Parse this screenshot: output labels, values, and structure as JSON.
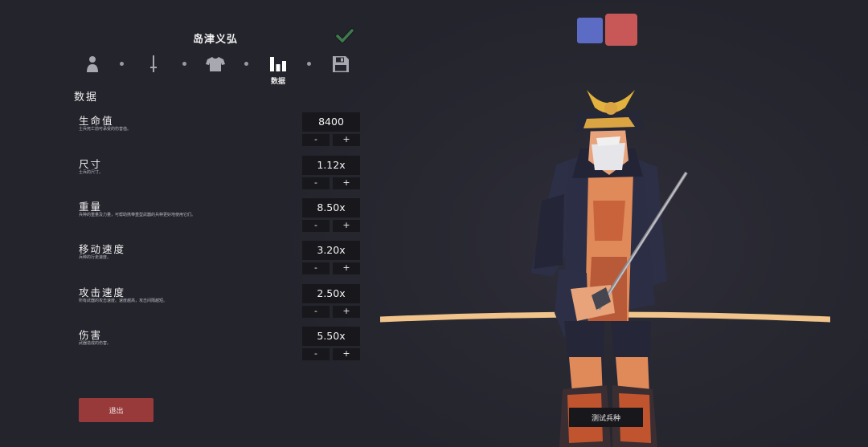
{
  "unit": {
    "name": "岛津义弘"
  },
  "tabs": [
    {
      "icon": "person-icon",
      "label": ""
    },
    {
      "icon": "sword-icon",
      "label": ""
    },
    {
      "icon": "shirt-icon",
      "label": ""
    },
    {
      "icon": "bar-chart-icon",
      "label": "数据"
    },
    {
      "icon": "save-icon",
      "label": ""
    }
  ],
  "stats_section": {
    "title": "数据",
    "rows": [
      {
        "name": "生命值",
        "desc": "士兵死亡前可承受的伤害值。",
        "value": "8400",
        "minus": "-",
        "plus": "+"
      },
      {
        "name": "尺寸",
        "desc": "士兵的尺寸。",
        "value": "1.12x",
        "minus": "-",
        "plus": "+"
      },
      {
        "name": "重量",
        "desc": "兵种的重量及力量，可帮助携带重型武器的兵种更好地使用它们。",
        "value": "8.50x",
        "minus": "-",
        "plus": "+"
      },
      {
        "name": "移动速度",
        "desc": "兵种的行走速度。",
        "value": "3.20x",
        "minus": "-",
        "plus": "+"
      },
      {
        "name": "攻击速度",
        "desc": "所有武器的攻击速度。速度越高，攻击间隔越短。",
        "value": "2.50x",
        "minus": "-",
        "plus": "+"
      },
      {
        "name": "伤害",
        "desc": "武器造成的伤害。",
        "value": "5.50x",
        "minus": "-",
        "plus": "+"
      }
    ]
  },
  "buttons": {
    "exit": "退出",
    "test_unit": "测试兵种"
  },
  "colors": {
    "background": "#262630",
    "team_blue": "#5c6bc4",
    "team_red": "#c85858",
    "exit_button": "#983a3a",
    "confirm_check": "#3d7a4c",
    "ground_line": "#f0c48a"
  }
}
